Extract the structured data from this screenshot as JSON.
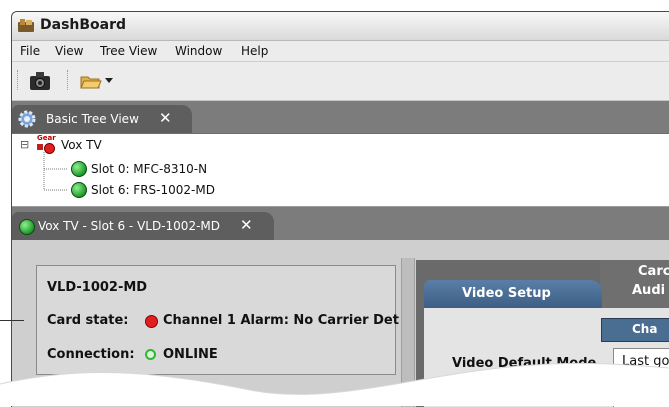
{
  "window": {
    "title": "DashBoard"
  },
  "menu": [
    "File",
    "View",
    "Tree View",
    "Window",
    "Help"
  ],
  "tree_tab": {
    "label": "Basic Tree View",
    "close": "✕"
  },
  "tree": {
    "root_label": "Vox TV",
    "root_icon_text": "Gear",
    "expander": "⊟",
    "slots": [
      {
        "label": "Slot 0: MFC-8310-N",
        "status": "green"
      },
      {
        "label": "Slot 6: FRS-1002-MD",
        "status": "green"
      }
    ]
  },
  "device_tab": {
    "label": "Vox TV - Slot 6 - VLD-1002-MD",
    "close": "✕"
  },
  "device_info": {
    "name": "VLD-1002-MD",
    "card_state_label": "Card state:",
    "card_state_value": "Channel 1 Alarm: No Carrier Det",
    "card_state_color": "#e02020",
    "connection_label": "Connection:",
    "connection_value": "ONLINE",
    "connection_color": "#2fb82f"
  },
  "config_tabs": {
    "top_partial_1": "Carc",
    "top_partial_2": "Audi",
    "active": "Video Setup"
  },
  "channel_header_partial": "Cha",
  "video_default_mode": {
    "label": "Video Default Mode",
    "value": "Last goo"
  },
  "colors": {
    "accent_blue": "#4a6d92",
    "tab_dark": "#5e5e5e"
  }
}
